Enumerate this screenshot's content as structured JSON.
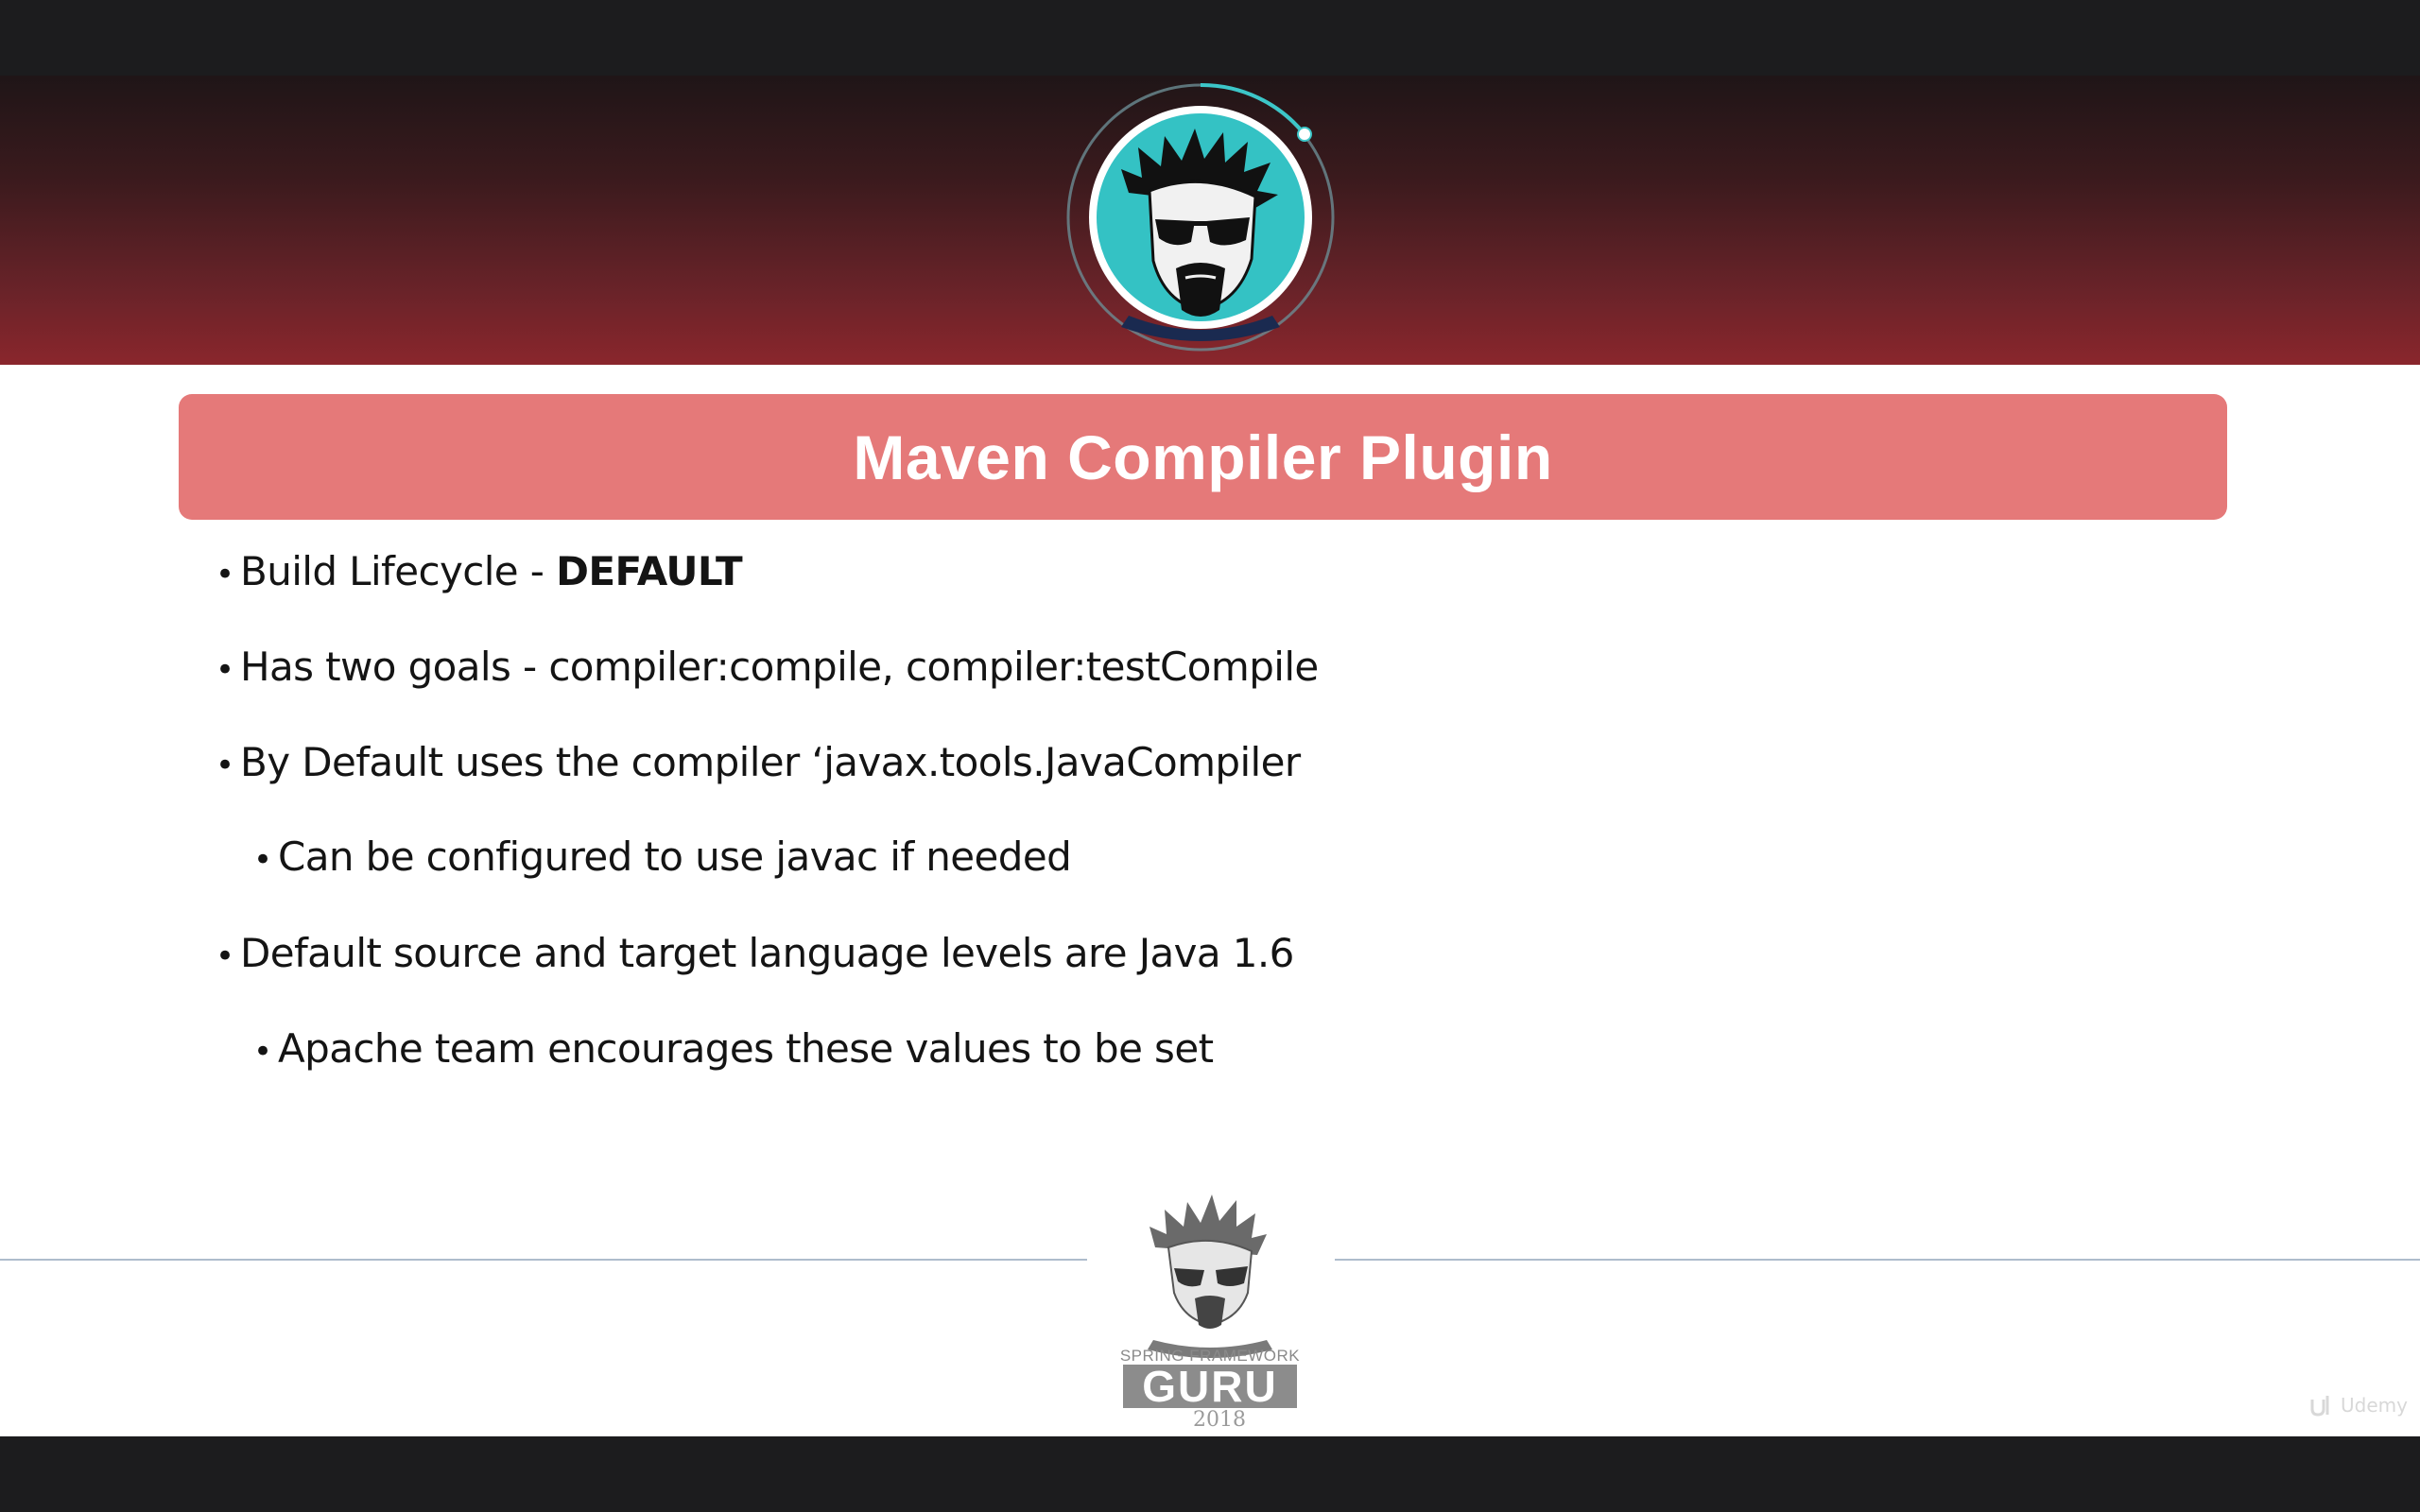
{
  "slide": {
    "title": "Maven Compiler Plugin",
    "bullets": [
      {
        "level": 1,
        "text": "Build Lifecycle - ",
        "bold": "DEFAULT"
      },
      {
        "level": 1,
        "text": "Has two goals - compiler:compile, compiler:testCompile"
      },
      {
        "level": 1,
        "text": "By Default uses the compiler ‘javax.tools.JavaCompiler"
      },
      {
        "level": 2,
        "text": "Can be configured to use javac if needed"
      },
      {
        "level": 1,
        "text": "Default source and target language levels are Java 1.6"
      },
      {
        "level": 2,
        "text": "Apache team encourages these values to be set"
      }
    ]
  },
  "header": {
    "avatar_icon": "cartoon-guru-avatar"
  },
  "footer": {
    "logo_tagline": "SPRING FRAMEWORK",
    "logo_word": "GURU",
    "year": "2018"
  },
  "watermark": {
    "text": "Udemy"
  },
  "colors": {
    "title_bar": "#e57979",
    "header_top": "#1f1517",
    "header_bottom": "#8a262c",
    "accent_ring": "#3cc6c8"
  }
}
